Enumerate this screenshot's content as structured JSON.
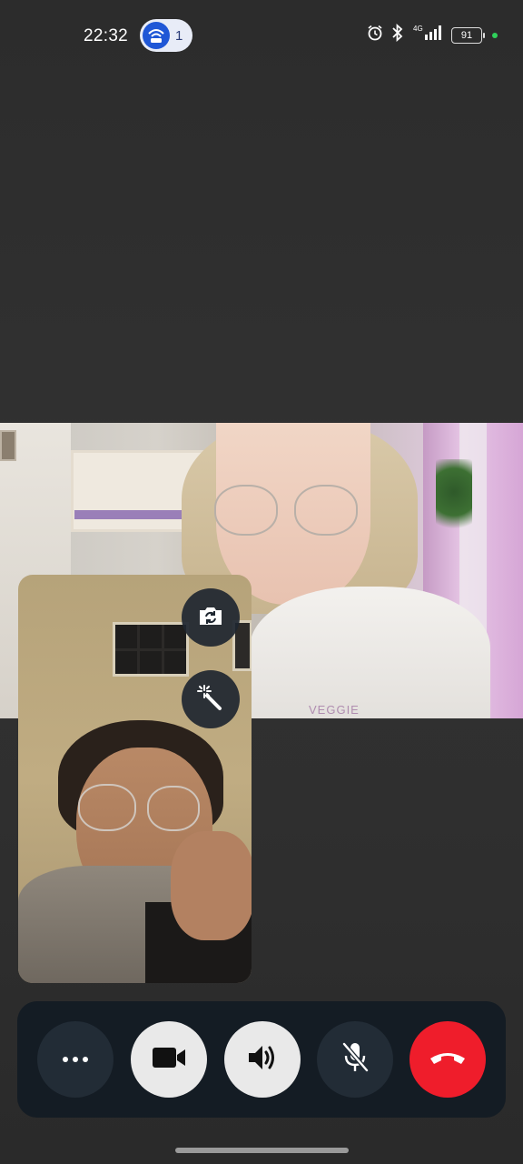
{
  "status_bar": {
    "time": "22:32",
    "hotspot_count": "1",
    "battery_level": "91",
    "icons": [
      "alarm-icon",
      "bluetooth-icon",
      "4g-signal-icon",
      "battery-icon"
    ]
  },
  "remote_video": {
    "hoodie_text": "VEGGIE"
  },
  "local_preview": {
    "buttons": [
      "flip-camera-icon",
      "magic-effects-icon"
    ]
  },
  "controls": {
    "items": [
      "more-options",
      "video",
      "speaker",
      "mute-microphone",
      "end-call"
    ],
    "colors": {
      "bar_bg": "#141c24",
      "dark_btn": "#222c36",
      "light_btn": "#e9e9e9",
      "end_call": "#ef1d2b"
    }
  }
}
